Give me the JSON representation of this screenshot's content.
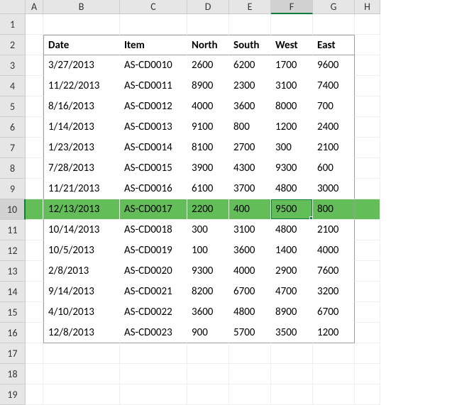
{
  "columns": [
    "A",
    "B",
    "C",
    "D",
    "E",
    "F",
    "G",
    "H"
  ],
  "row_count": 19,
  "selected_col": "F",
  "selected_row": 10,
  "highlight_row": 10,
  "table": {
    "range": {
      "col_start": "B",
      "col_end": "G",
      "row_start": 2,
      "row_end": 16
    },
    "headers": [
      "Date",
      "Item",
      "North",
      "South",
      "West",
      "East"
    ],
    "rows": [
      [
        "3/27/2013",
        "AS-CD0010",
        "2600",
        "6200",
        "1700",
        "9600"
      ],
      [
        "11/22/2013",
        "AS-CD0011",
        "8900",
        "2300",
        "3100",
        "7400"
      ],
      [
        "8/16/2013",
        "AS-CD0012",
        "4000",
        "3600",
        "8000",
        "700"
      ],
      [
        "1/14/2013",
        "AS-CD0013",
        "9100",
        "800",
        "1200",
        "2400"
      ],
      [
        "1/23/2013",
        "AS-CD0014",
        "8100",
        "2700",
        "300",
        "2100"
      ],
      [
        "7/28/2013",
        "AS-CD0015",
        "3900",
        "4300",
        "9300",
        "600"
      ],
      [
        "11/21/2013",
        "AS-CD0016",
        "6100",
        "3700",
        "4800",
        "3000"
      ],
      [
        "12/13/2013",
        "AS-CD0017",
        "2200",
        "400",
        "9500",
        "800"
      ],
      [
        "10/14/2013",
        "AS-CD0018",
        "300",
        "3100",
        "4800",
        "2100"
      ],
      [
        "10/5/2013",
        "AS-CD0019",
        "100",
        "3600",
        "1400",
        "4000"
      ],
      [
        "2/8/2013",
        "AS-CD0020",
        "9300",
        "4000",
        "2900",
        "7600"
      ],
      [
        "9/14/2013",
        "AS-CD0021",
        "8200",
        "6700",
        "4700",
        "3200"
      ],
      [
        "4/10/2013",
        "AS-CD0022",
        "3600",
        "4800",
        "8900",
        "6700"
      ],
      [
        "12/8/2013",
        "AS-CD0023",
        "900",
        "5700",
        "3500",
        "1200"
      ]
    ]
  },
  "chart_data": {
    "type": "table",
    "title": "",
    "columns": [
      "Date",
      "Item",
      "North",
      "South",
      "West",
      "East"
    ],
    "rows": [
      [
        "3/27/2013",
        "AS-CD0010",
        2600,
        6200,
        1700,
        9600
      ],
      [
        "11/22/2013",
        "AS-CD0011",
        8900,
        2300,
        3100,
        7400
      ],
      [
        "8/16/2013",
        "AS-CD0012",
        4000,
        3600,
        8000,
        700
      ],
      [
        "1/14/2013",
        "AS-CD0013",
        9100,
        800,
        1200,
        2400
      ],
      [
        "1/23/2013",
        "AS-CD0014",
        8100,
        2700,
        300,
        2100
      ],
      [
        "7/28/2013",
        "AS-CD0015",
        3900,
        4300,
        9300,
        600
      ],
      [
        "11/21/2013",
        "AS-CD0016",
        6100,
        3700,
        4800,
        3000
      ],
      [
        "12/13/2013",
        "AS-CD0017",
        2200,
        400,
        9500,
        800
      ],
      [
        "10/14/2013",
        "AS-CD0018",
        300,
        3100,
        4800,
        2100
      ],
      [
        "10/5/2013",
        "AS-CD0019",
        100,
        3600,
        1400,
        4000
      ],
      [
        "2/8/2013",
        "AS-CD0020",
        9300,
        4000,
        2900,
        7600
      ],
      [
        "9/14/2013",
        "AS-CD0021",
        8200,
        6700,
        4700,
        3200
      ],
      [
        "4/10/2013",
        "AS-CD0022",
        3600,
        4800,
        8900,
        6700
      ],
      [
        "12/8/2013",
        "AS-CD0023",
        900,
        5700,
        3500,
        1200
      ]
    ]
  }
}
